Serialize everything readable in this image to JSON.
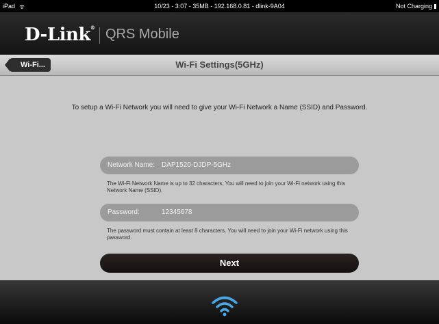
{
  "statusbar": {
    "device": "iPad",
    "info": "10/23 - 3:07 - 35MB - 192.168.0.81 - dlink-9A04",
    "battery": "Not Charging"
  },
  "header": {
    "logo": "D-Link",
    "app_title": "QRS Mobile"
  },
  "navbar": {
    "back_label": "Wi-Fi...",
    "title": "Wi-Fi Settings(5GHz)"
  },
  "main": {
    "intro": "To setup a Wi-Fi Network you will need to give your Wi-Fi Network a Name (SSID) and Password.",
    "network_name_label": "Network Name:",
    "network_name_value": "DAP1520-DJDP-5GHz",
    "network_hint": "The Wi-Fi Network Name is up to 32 characters. You will need to join your Wi-Fi network using this Network Name (SSID).",
    "password_label": "Password:",
    "password_value": "12345678",
    "password_hint": "The password must contain at least 8 characters.  You will need to join your Wi-Fi network using this password.",
    "next_label": "Next"
  },
  "icons": {
    "footer_icon": "wifi-icon",
    "accent_color": "#4aa8e8"
  }
}
